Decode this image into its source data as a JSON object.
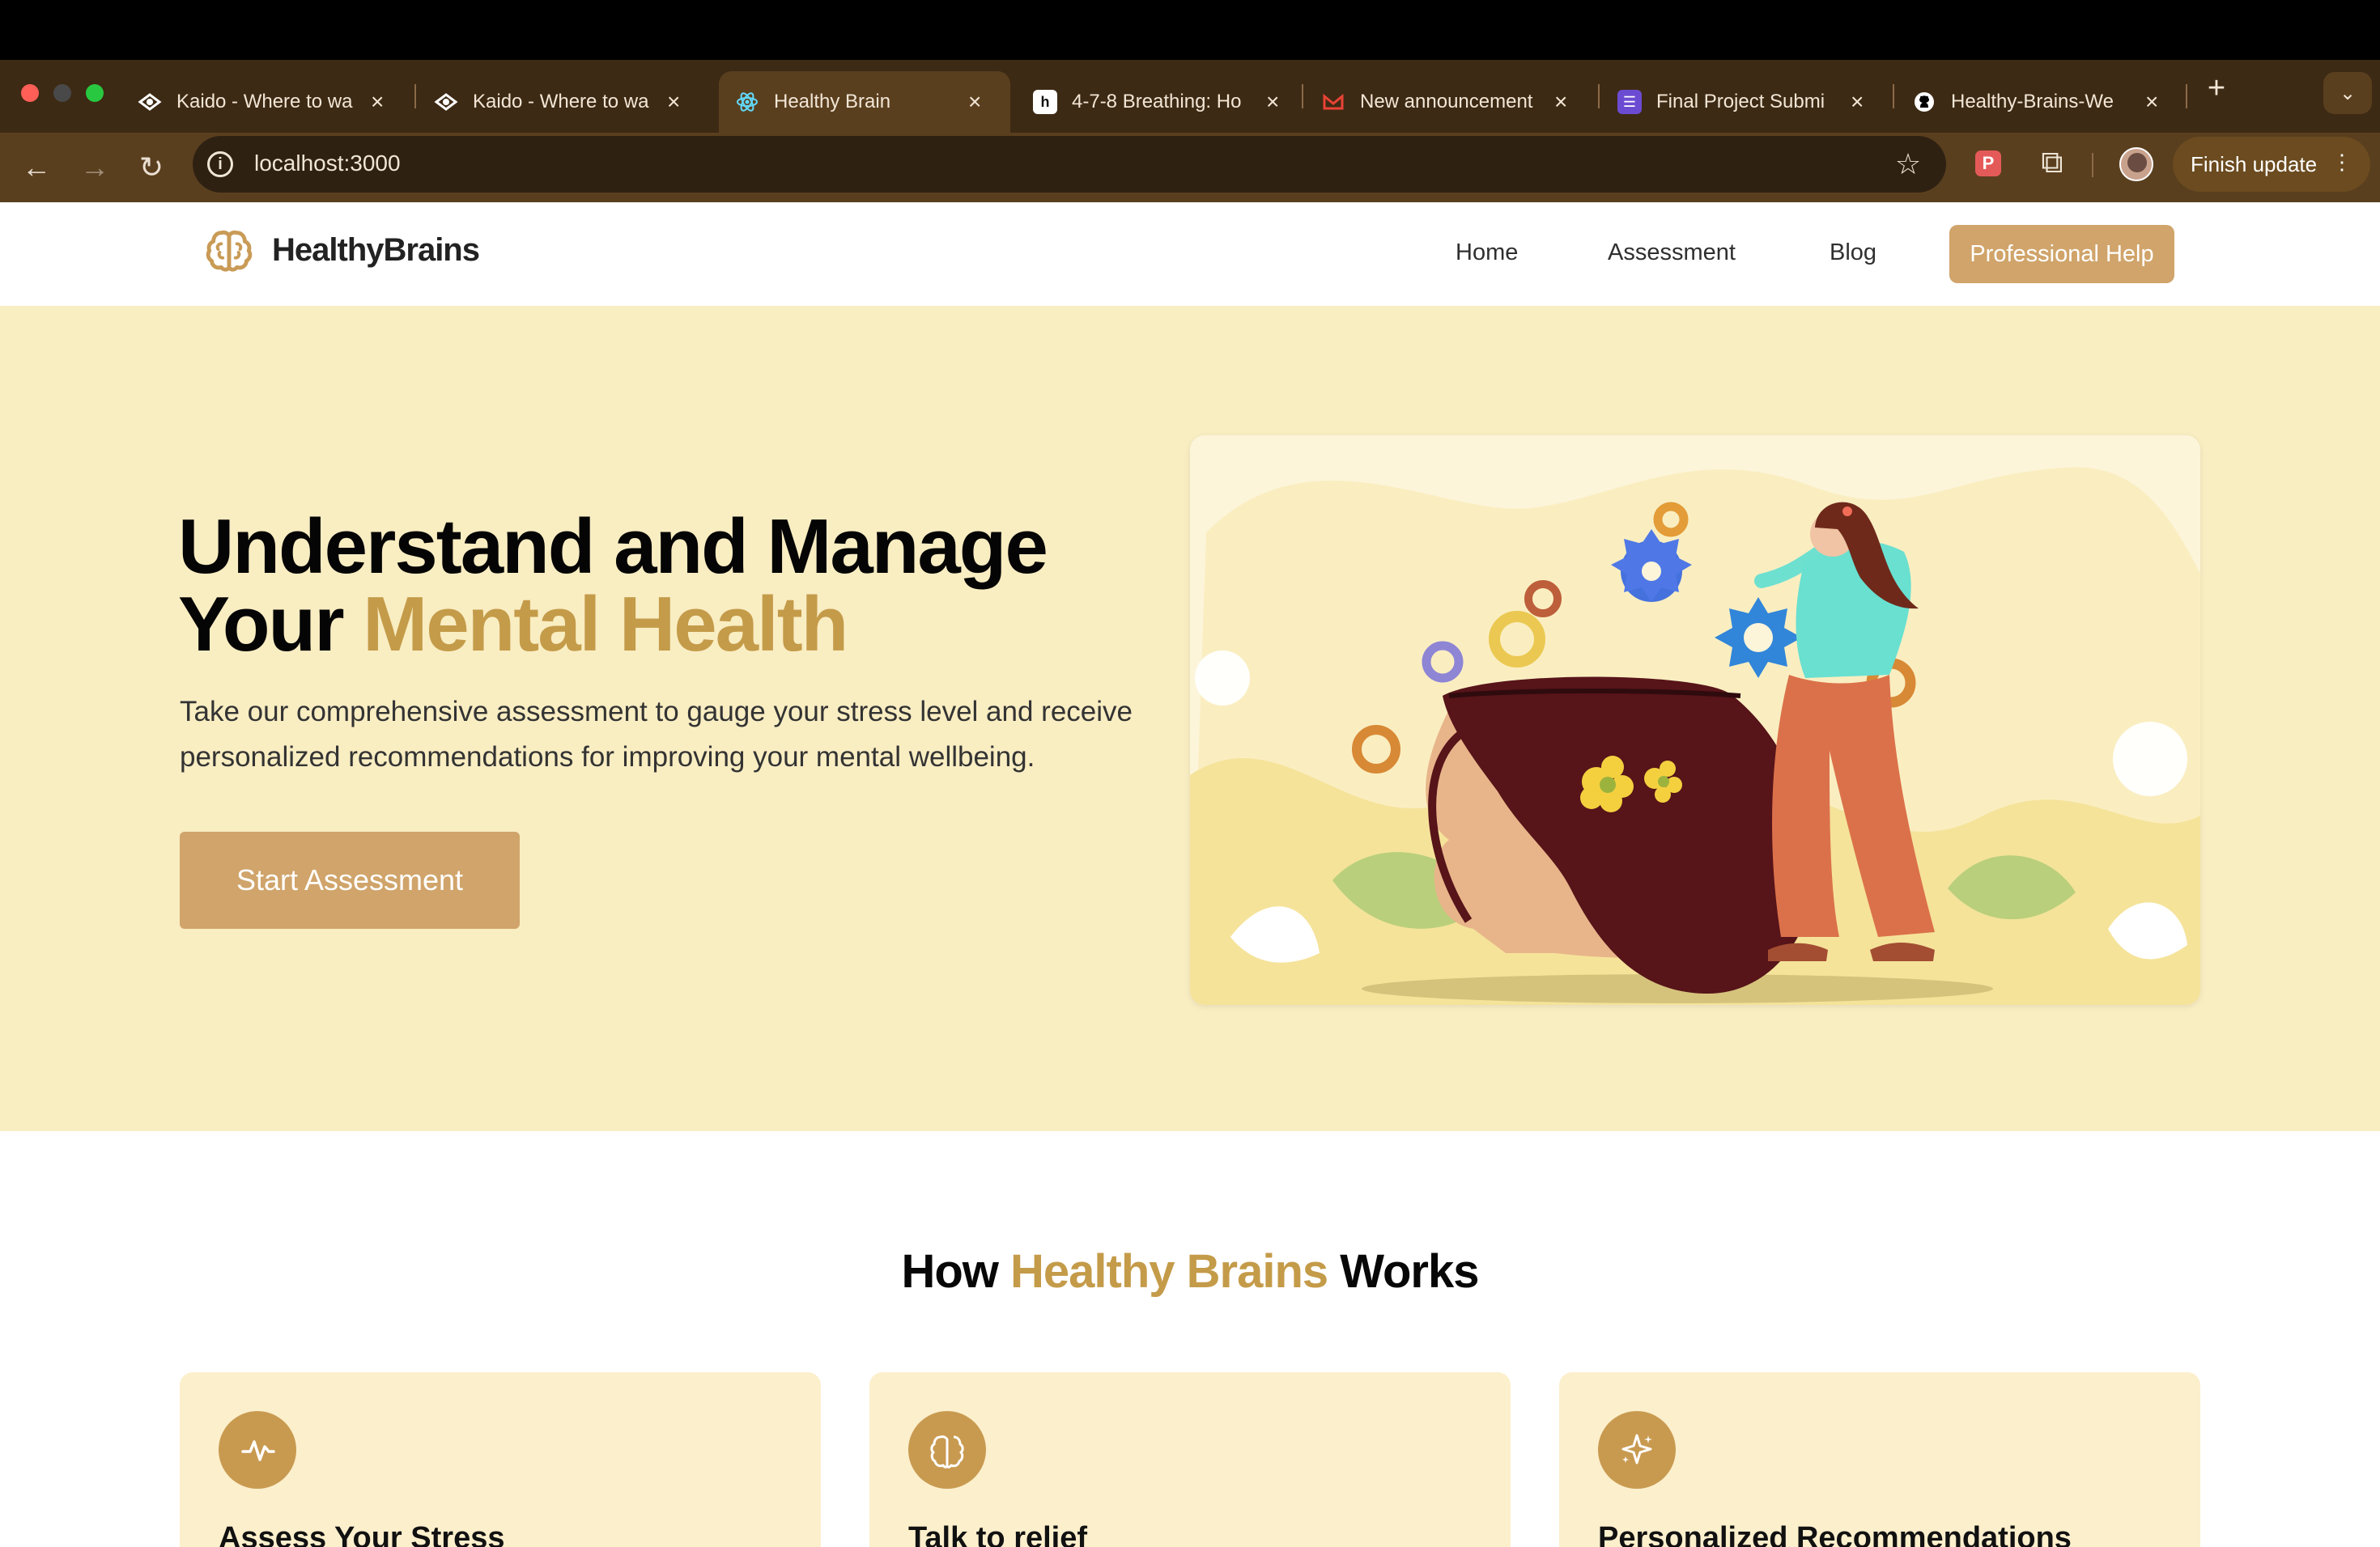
{
  "browser": {
    "tabs": [
      {
        "title": "Kaido - Where to wa",
        "icon": "kaido-icon"
      },
      {
        "title": "Kaido - Where to wa",
        "icon": "kaido-icon"
      },
      {
        "title": "Healthy Brain",
        "icon": "react-icon"
      },
      {
        "title": "4-7-8 Breathing: Ho",
        "icon": "h-icon"
      },
      {
        "title": "New announcement",
        "icon": "gmail-icon"
      },
      {
        "title": "Final Project Submi",
        "icon": "form-icon"
      },
      {
        "title": "Healthy-Brains-We",
        "icon": "github-icon"
      }
    ],
    "address": "localhost:3000",
    "finish_update": "Finish update"
  },
  "site": {
    "logo_text": "HealthyBrains",
    "nav": [
      "Home",
      "Assessment",
      "Blog"
    ],
    "professional_help": "Professional Help"
  },
  "hero": {
    "title_part1": "Understand and Manage",
    "title_part2": "Your ",
    "title_accent": "Mental Health",
    "description": "Take our comprehensive assessment to gauge your stress level and receive personalized recommendations for improving your mental wellbeing.",
    "start_button": "Start Assessment"
  },
  "works": {
    "title_prefix": "How ",
    "title_accent": "Healthy Brains",
    "title_suffix": " Works",
    "cards": [
      {
        "title": "Assess Your Stress",
        "icon": "pulse-icon"
      },
      {
        "title": "Talk to relief",
        "icon": "brain-icon"
      },
      {
        "title": "Personalized Recommendations",
        "icon": "sparkle-icon"
      }
    ]
  },
  "colors": {
    "accent": "#c49b49",
    "button": "#d0a46a",
    "hero_background": "#f9edc2"
  }
}
